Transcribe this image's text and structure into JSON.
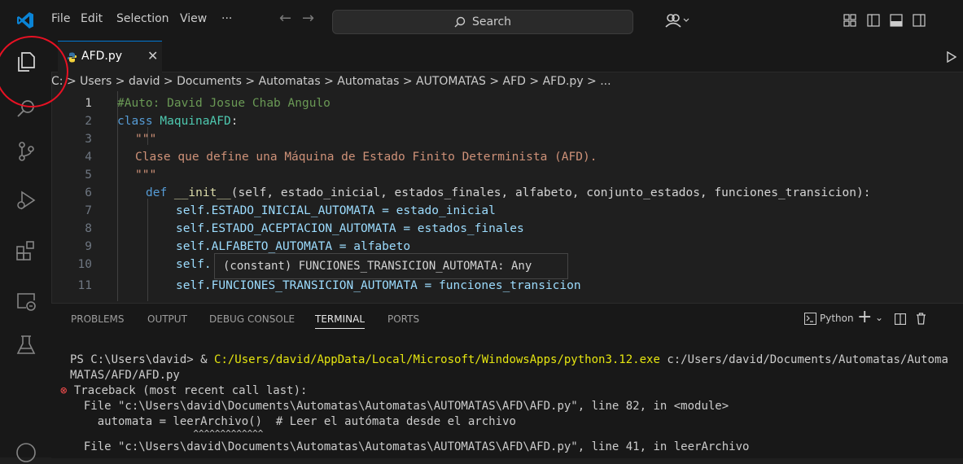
{
  "titlebar": {
    "menu": [
      "File",
      "Edit",
      "Selection",
      "View",
      "···"
    ],
    "search_label": "Search"
  },
  "tab": {
    "name": "AFD.py"
  },
  "breadcrumb": "C: > Users > david > Documents > Automatas > Automatas > AUTOMATAS > AFD > AFD.py > ...",
  "editor": {
    "lines": [
      "1",
      "2",
      "3",
      "4",
      "5",
      "6",
      "7",
      "8",
      "9",
      "10",
      "11"
    ],
    "code": {
      "l1": "#Auto: David Josue Chab Angulo",
      "l2_kw": "class ",
      "l2_cls": "MaquinaAFD",
      "l2_rest": ":",
      "l3": "\"\"\"",
      "l4": "Clase que define una Máquina de Estado Finito Determinista (AFD).",
      "l5": "\"\"\"",
      "l6_kw": "def ",
      "l6_fn": "__init__",
      "l6_rest": "(self, estado_inicial, estados_finales, alfabeto, conjunto_estados, funciones_transicion):",
      "l7": "self.ESTADO_INICIAL_AUTOMATA = estado_inicial",
      "l8": "self.ESTADO_ACEPTACION_AUTOMATA = estados_finales",
      "l9": "self.ALFABETO_AUTOMATA = alfabeto",
      "l10": "self.",
      "l11": "self.FUNCIONES_TRANSICION_AUTOMATA = funciones_transicion"
    },
    "hover": "(constant) FUNCIONES_TRANSICION_AUTOMATA: Any"
  },
  "panel": {
    "tabs": [
      "PROBLEMS",
      "OUTPUT",
      "DEBUG CONSOLE",
      "TERMINAL",
      "PORTS"
    ],
    "terminal_label": "Python",
    "terminal": {
      "cmd_prompt": "PS C:\\Users\\david> & ",
      "cmd_exe": "C:/Users/david/AppData/Local/Microsoft/WindowsApps/python3.12.exe",
      "cmd_arg": " c:/Users/david/Documents/Automatas/Automa",
      "cmd_cont": "MATAS/AFD/AFD.py",
      "tb": "Traceback (most recent call last):",
      "file1": "  File \"c:\\Users\\david\\Documents\\Automatas\\Automatas\\AUTOMATAS\\AFD\\AFD.py\", line 82, in <module>",
      "code1": "    automata = leerArchivo()  # Leer el autómata desde el archivo",
      "marks": "               ^^^^^^^^^^^^^",
      "file2": "  File \"c:\\Users\\david\\Documents\\Automatas\\Automatas\\AUTOMATAS\\AFD\\AFD.py\", line 41, in leerArchivo"
    }
  },
  "colors": {
    "accent": "#0078d4",
    "annotation": "#e81123"
  }
}
